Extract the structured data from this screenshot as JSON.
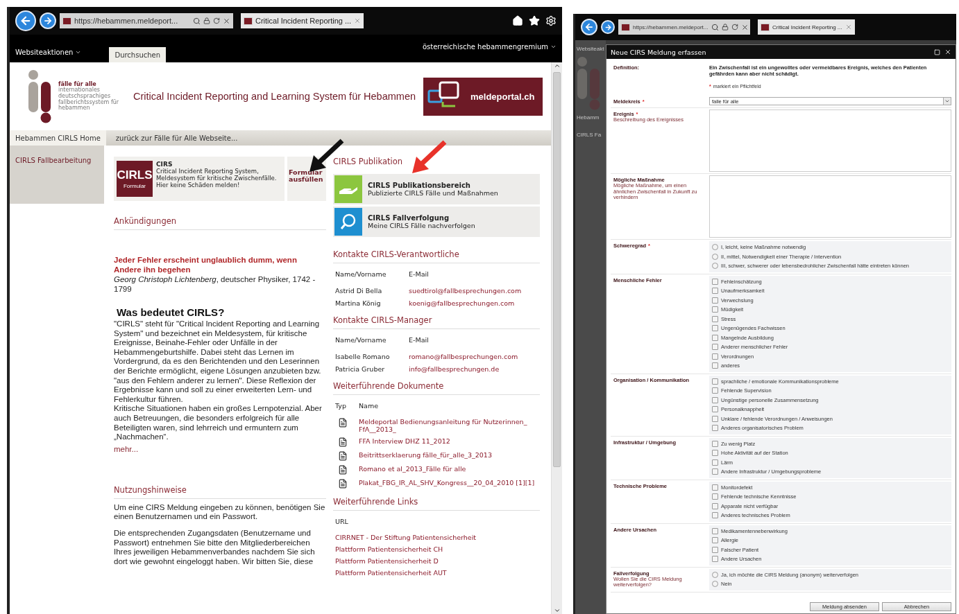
{
  "left_window": {
    "browser": {
      "address": "https://hebammen.meldeport...",
      "tab_title": "Critical Incident Reporting ..."
    },
    "suite_bar": {
      "menu": "Websiteaktionen",
      "tabs": [
        {
          "label": "Durchsuchen",
          "selected": true
        }
      ],
      "site_menu": "österreichische hebammengremium"
    },
    "header": {
      "logo_title": "fälle für alle",
      "logo_subtitle": "internationales deutschsprachiges fallberichtssystem für hebammen",
      "title": "Critical Incident Reporting and Learning System für Hebammen",
      "banner": "meldeportal.ch"
    },
    "nav": [
      {
        "label": "Hebammen CIRLS Home",
        "selected": true
      },
      {
        "label": "zurück zur Fälle für Alle Webseite...",
        "selected": false
      }
    ],
    "sidebar": {
      "items": [
        "CIRLS Fallbearbeitung"
      ]
    },
    "cirs_tile": {
      "badge_title": "CIRLS",
      "badge_subtitle": "Formular",
      "title": "CIRS",
      "description": "Critical Incident Reporting System, Meldesystem für kritische Zwischenfälle. Hier keine Schäden melden!",
      "action": "Formular ausfüllen"
    },
    "announcements": {
      "heading": "Ankündigungen",
      "quote": "Jeder Fehler erscheint unglaublich dumm, wenn Andere ihn begehen",
      "author": "*Georg Christoph Lichtenberg*, deutscher Physiker, 1742 - 1799"
    },
    "about": {
      "heading": "Was bedeutet CIRLS?",
      "paragraphs": [
        "\"CIRLS\" steht für \"Critical Incident Reporting and Learning System\" und bezeichnet ein Meldesystem, für kritische Ereignisse, Beinahe-Fehler oder Unfälle in der Hebammengeburtshilfe. Dabei steht das Lernen im Vordergrund, da es den Berichtenden und den Leserinnen der Berichte ermöglicht, eigene Lösungen anzubieten bzw. \"aus den Fehlern anderer zu lernen\". Diese Reflexion der Ergebnisse kann und soll zu einer erweiterten Lern- und Fehlerkultur führen.",
        "Kritische Situationen haben ein großes Lernpotenzial. Aber auch Betreuungen, die besonders erfolgreich für alle Beteiligten waren, sind lehrreich und ermuntern zum „Nachmachen“."
      ],
      "more": "mehr..."
    },
    "usage": {
      "heading": "Nutzungshinweise",
      "paragraphs": [
        "Um eine CIRS Meldung eingeben zu können, benötigen Sie einen Benutzernamen und ein Passwort.",
        "Die entsprechenden Zugangsdaten (Benutzername und Passwort) entnehmen Sie bitte den Mitgliederbereichen Ihres jeweiligen Hebammenverbandes nachdem Sie sich dort wie gewohnt eingeloggt haben. Wir bitten Sie, diese"
      ]
    },
    "publication": {
      "heading": "CIRLS Publikation",
      "tiles": [
        {
          "kind": "publication",
          "title": "CIRLS Publikationsbereich",
          "subtitle": "Publizierte CIRLS Fälle und Maßnahmen"
        },
        {
          "kind": "tracking",
          "title": "CIRLS Fallverfolgung",
          "subtitle": "Meine CIRLS Fälle nachverfolgen"
        }
      ]
    },
    "contacts": [
      {
        "heading": "Kontakte CIRLS-Verantwortliche",
        "columns": [
          "Name/Vorname",
          "E-Mail"
        ],
        "rows": [
          [
            "Astrid Di Bella",
            "suedtirol@fallbesprechungen.com"
          ],
          [
            "Martina König",
            "koenig@fallbesprechungen.com"
          ]
        ]
      },
      {
        "heading": "Kontakte CIRLS-Manager",
        "columns": [
          "Name/Vorname",
          "E-Mail"
        ],
        "rows": [
          [
            "Isabelle Romano",
            "romano@fallbesprechungen.com"
          ],
          [
            "Patricia Gruber",
            "info@fallbesprechungen.de"
          ]
        ]
      }
    ],
    "documents": {
      "heading": "Weiterführende Dokumente",
      "columns": [
        "Typ",
        "Name"
      ],
      "rows": [
        "Meldeportal Bedienungsanleitung für Nutzerinnen_ FfA__2013_",
        "FFA Interview DHZ 11_2012",
        "Beitrittserklaerung fälle_für_alle_3_2013",
        "Romano et al_2013_Fälle für alle",
        "Plakat_FBG_IR_AL_SHV_Kongress__20_04_2010 [1][1]"
      ]
    },
    "links": {
      "heading": "Weiterführende Links",
      "column": "URL",
      "items": [
        "CIRRNET - Der Stiftung Patientensicherheit",
        "Plattform Patientensicherheit CH",
        "Plattform Patientensicherheit D",
        "Plattform Patientensicherheit AUT"
      ]
    },
    "annotations": [
      {
        "color": "#111111"
      },
      {
        "color": "#e8322a"
      }
    ]
  },
  "right_window": {
    "browser": {
      "address": "https://hebammen.meldeport...",
      "tab_title": "Critical Incident Reporting ..."
    },
    "background_texts": [
      "Websiteakt",
      "Hebamm",
      "CIRLS Fa"
    ],
    "dialog": {
      "title": "Neue CIRS Meldung erfassen",
      "definition_label": "Definition:",
      "definition": "Ein Zwischenfall ist ein ungewolltes oder vermeidbares Ereignis, welches den Patienten gefährden kann aber nicht schädigt.",
      "required_mark": "*",
      "required_note": "markiert ein Pflichtfeld",
      "fields": [
        {
          "kind": "select",
          "label": "Meldekreis",
          "required_mark": "*",
          "value": "falle für alle"
        },
        {
          "kind": "textarea",
          "label": "Ereignis",
          "required_mark": "*",
          "description": "Beschreibung des Ereignisses"
        },
        {
          "kind": "textarea",
          "label": "Mögliche Maßnahme",
          "description": "Mögliche Maßnahme, um einen ähnlichen Zwischenfall in Zukunft zu verhindern"
        },
        {
          "kind": "radio",
          "label": "Schweregrad",
          "required_mark": "*",
          "options": [
            {
              "label": "I, leicht, keine Maßnahme notwendig",
              "selected": false
            },
            {
              "label": "II, mittel, Notwendigkeit einer Therapie / Intervention",
              "selected": false
            },
            {
              "label": "III, schwer, schwerer oder lebensbedrohlicher Zwischenfall hätte eintreten können",
              "selected": false
            }
          ]
        },
        {
          "kind": "checkbox",
          "label": "Menschliche Fehler",
          "options": [
            {
              "label": "Fehleinschätzung",
              "checked": false
            },
            {
              "label": "Unaufmerksamkeit",
              "checked": false
            },
            {
              "label": "Verwechslung",
              "checked": false
            },
            {
              "label": "Müdigkeit",
              "checked": false
            },
            {
              "label": "Stress",
              "checked": false
            },
            {
              "label": "Ungenügendes Fachwissen",
              "checked": false
            },
            {
              "label": "Mangelnde Ausbildung",
              "checked": false
            },
            {
              "label": "Anderer menschlicher Fehler",
              "checked": false
            },
            {
              "label": "Verordnungen",
              "checked": false
            },
            {
              "label": "anderes",
              "checked": false
            }
          ]
        },
        {
          "kind": "checkbox",
          "label": "Organisation / Kommunikation",
          "options": [
            {
              "label": "sprachliche / emotionale Kommunikationsprobleme",
              "checked": false
            },
            {
              "label": "Fehlende Supervision",
              "checked": false
            },
            {
              "label": "Ungünstige personelle Zusammensetzung",
              "checked": false
            },
            {
              "label": "Personalknappheit",
              "checked": false
            },
            {
              "label": "Unklare / fehlende Verordnungen / Anweisungen",
              "checked": false
            },
            {
              "label": "Anderes organisatorisches Problem",
              "checked": false
            }
          ]
        },
        {
          "kind": "checkbox",
          "label": "Infrastruktur / Umgebung",
          "options": [
            {
              "label": "Zu wenig Platz",
              "checked": false
            },
            {
              "label": "Hohe Aktivität auf der Station",
              "checked": false
            },
            {
              "label": "Lärm",
              "checked": false
            },
            {
              "label": "Andere Infrastruktur / Umgebungsprobleme",
              "checked": false
            }
          ]
        },
        {
          "kind": "checkbox",
          "label": "Technische Probleme",
          "options": [
            {
              "label": "Monitordefekt",
              "checked": false
            },
            {
              "label": "Fehlende technische Kenntnisse",
              "checked": false
            },
            {
              "label": "Apparate nicht verfügbar",
              "checked": false
            },
            {
              "label": "Anderes technisches Problem",
              "checked": false
            }
          ]
        },
        {
          "kind": "checkbox",
          "label": "Andere Ursachen",
          "options": [
            {
              "label": "Medikamentennebenwirkung",
              "checked": false
            },
            {
              "label": "Allergie",
              "checked": false
            },
            {
              "label": "Falscher Patient",
              "checked": false
            },
            {
              "label": "Andere Ursachen",
              "checked": false
            }
          ]
        },
        {
          "kind": "radio",
          "label": "Fallverfolgung",
          "description": "Wollen Sie die CIRS Meldung weiterverfolgen?",
          "options": [
            {
              "label": "Ja, ich möchte die CIRS Meldung (anonym) weiterverfolgen",
              "selected": false
            },
            {
              "label": "Nein",
              "selected": false
            }
          ]
        }
      ],
      "buttons": [
        "Meldung absenden",
        "Abbrechen"
      ]
    }
  }
}
